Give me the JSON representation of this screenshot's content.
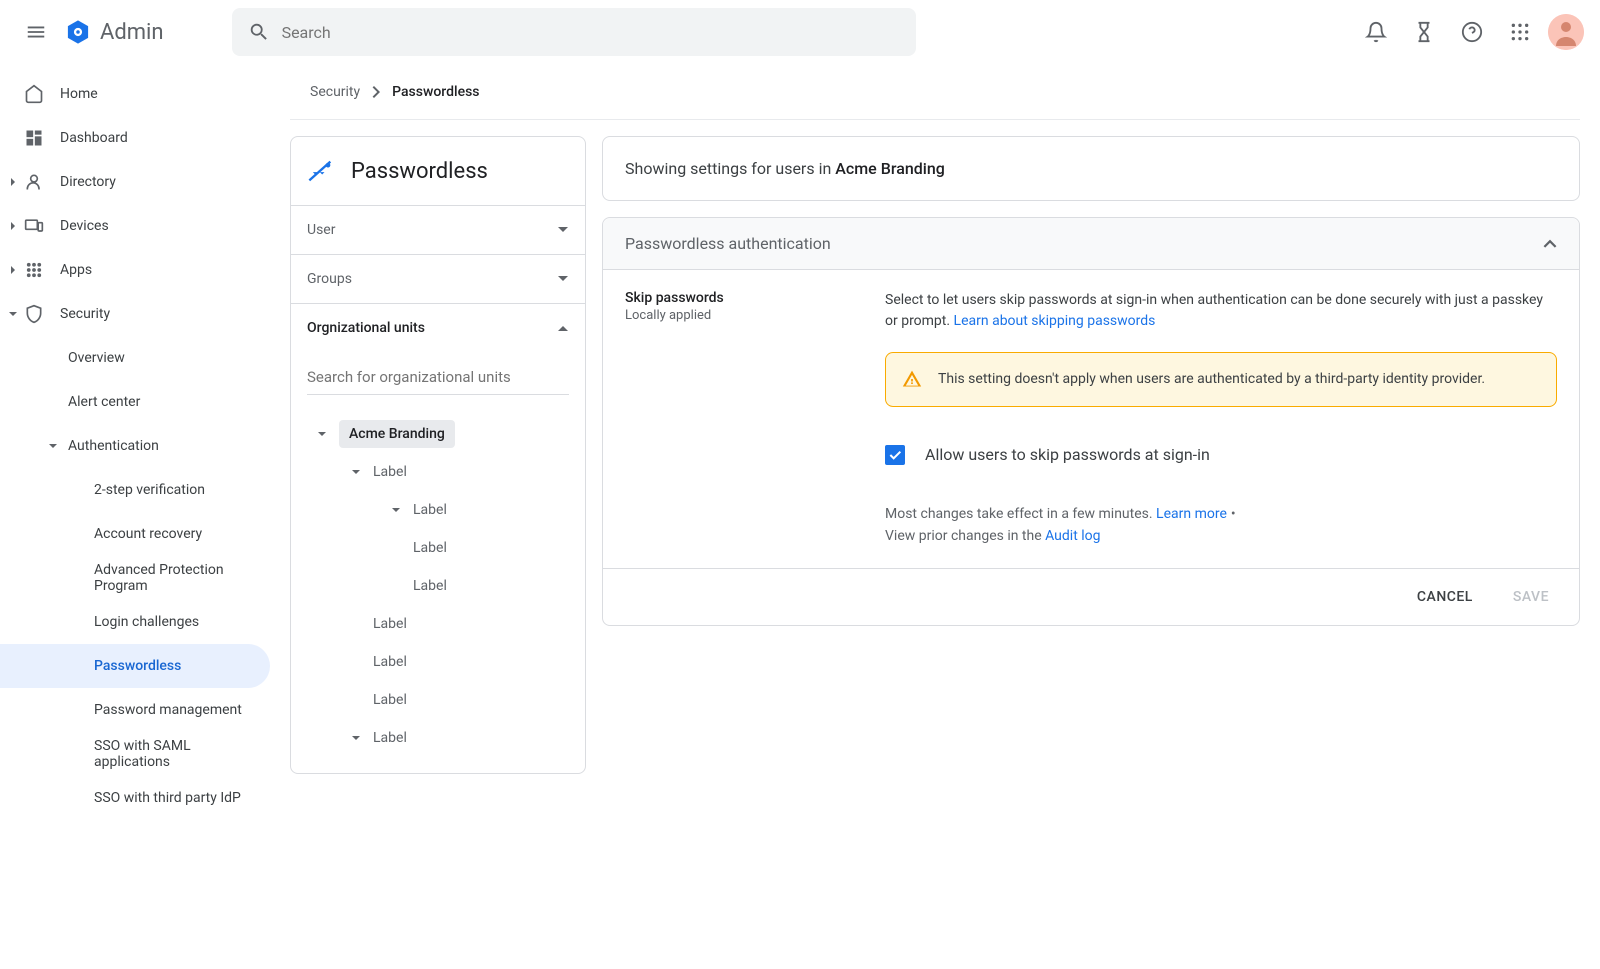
{
  "header": {
    "app_name": "Admin",
    "search_placeholder": "Search"
  },
  "sidebar": {
    "items": [
      {
        "label": "Home"
      },
      {
        "label": "Dashboard"
      },
      {
        "label": "Directory"
      },
      {
        "label": "Devices"
      },
      {
        "label": "Apps"
      },
      {
        "label": "Security"
      },
      {
        "label": "Overview"
      },
      {
        "label": "Alert center"
      },
      {
        "label": "Authentication"
      },
      {
        "label": "2-step verification"
      },
      {
        "label": "Account recovery"
      },
      {
        "label": "Advanced Protection Program"
      },
      {
        "label": "Login challenges"
      },
      {
        "label": "Passwordless"
      },
      {
        "label": "Password management"
      },
      {
        "label": "SSO with SAML applications"
      },
      {
        "label": "SSO with third party IdP"
      }
    ]
  },
  "breadcrumb": {
    "root": "Security",
    "current": "Passwordless"
  },
  "ou_panel": {
    "title": "Passwordless",
    "sections": {
      "user": "User",
      "groups": "Groups",
      "org_units": "Orgnizational units"
    },
    "search_placeholder": "Search for organizational units",
    "tree": {
      "root": "Acme Branding",
      "children": [
        "Label",
        "Label",
        "Label",
        "Label",
        "Label",
        "Label",
        "Label",
        "Label"
      ]
    }
  },
  "settings": {
    "showing_prefix": "Showing settings for users in ",
    "showing_org": "Acme Branding",
    "section_title": "Passwordless authentication",
    "skip_label": "Skip passwords",
    "applied": "Locally applied",
    "description": "Select to let users skip passwords at sign-in when authentication can be done securely with just a passkey or prompt. ",
    "learn_link": "Learn about skipping passwords",
    "warning": "This setting doesn't apply when users are authenticated by a third-party identity provider.",
    "checkbox_label": "Allow users to skip passwords at sign-in",
    "checkbox_checked": true,
    "footer1a": "Most changes take effect in a few minutes. ",
    "footer1_link": "Learn more",
    "footer2a": "View prior changes in the ",
    "footer2_link": "Audit log",
    "cancel": "CANCEL",
    "save": "SAVE"
  }
}
